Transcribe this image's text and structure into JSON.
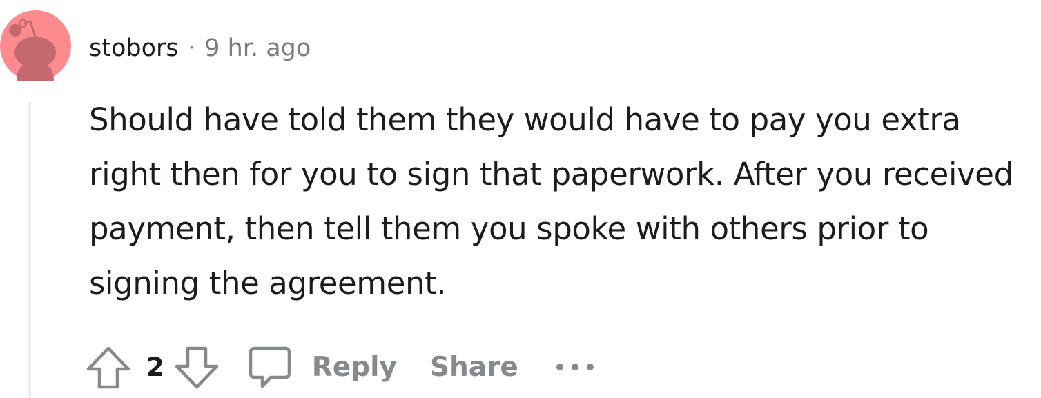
{
  "comment": {
    "username": "stobors",
    "separator": "·",
    "timestamp": "9 hr. ago",
    "body": "Should have told them they would have to pay you extra right then for you to sign that paperwork. After you received payment, then tell them you spoke with others prior to signing the agreement."
  },
  "actions": {
    "score": "2",
    "reply_label": "Reply",
    "share_label": "Share"
  },
  "icons": {
    "avatar": "snoo-avatar-icon",
    "upvote": "upvote-arrow-icon",
    "downvote": "downvote-arrow-icon",
    "reply": "speech-bubble-icon",
    "more": "ellipsis-icon"
  },
  "colors": {
    "avatar_bg": "#ff8b8f",
    "avatar_figure": "#c46a6e",
    "text_primary": "#1c1c1c",
    "text_meta": "#7c7c7c",
    "action_gray": "#878a8c",
    "thread_line": "#edeff1"
  }
}
